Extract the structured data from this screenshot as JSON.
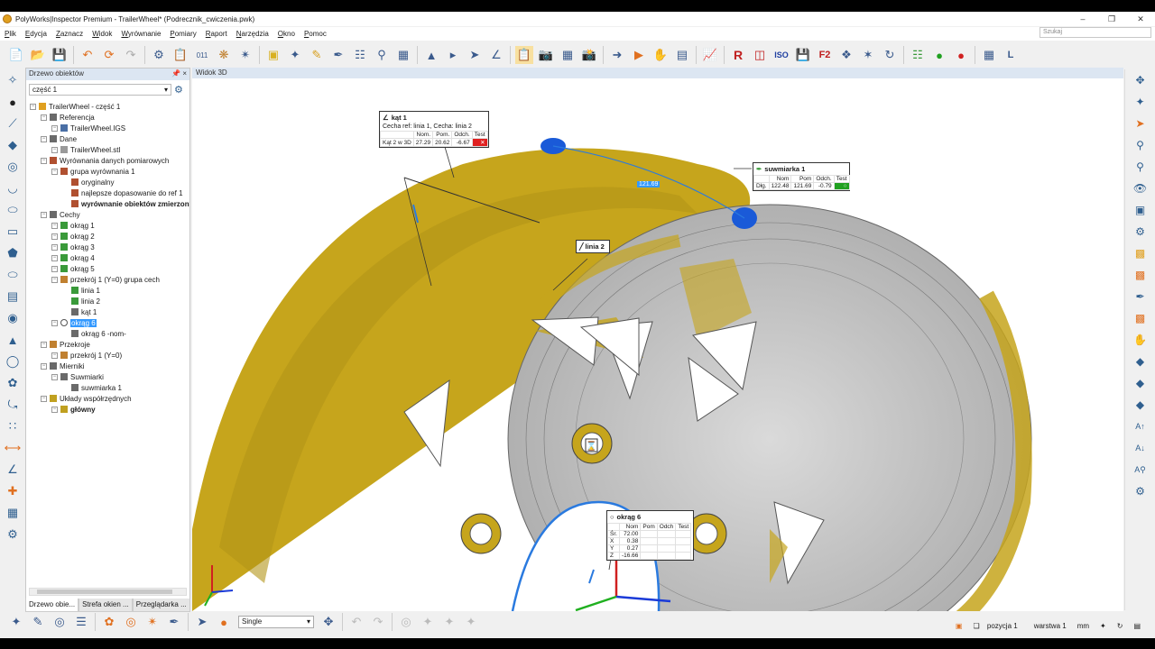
{
  "app_title": "PolyWorks|Inspector Premium - TrailerWheel* (Podrecznik_cwiczenia.pwk)",
  "menu": [
    "Plik",
    "Edycja",
    "Zaznacz",
    "Widok",
    "Wyrównanie",
    "Pomiary",
    "Raport",
    "Narzędzia",
    "Okno",
    "Pomoc"
  ],
  "search_placeholder": "Szukaj",
  "tree_panel": {
    "title": "Drzewo obiektów",
    "part_select": "część 1",
    "nodes": [
      {
        "label": "TrailerWheel - część 1",
        "lvl": 0,
        "icon": "#e0a020"
      },
      {
        "label": "Referencja",
        "lvl": 1,
        "icon": "#6a6a6a"
      },
      {
        "label": "TrailerWheel.IGS",
        "lvl": 2,
        "icon": "#4a6fa5"
      },
      {
        "label": "Dane",
        "lvl": 1,
        "icon": "#6a6a6a"
      },
      {
        "label": "TrailerWheel.stl",
        "lvl": 2,
        "icon": "#9a9a9a"
      },
      {
        "label": "Wyrównania danych pomiarowych",
        "lvl": 1,
        "icon": "#b05030"
      },
      {
        "label": "grupa wyrównania 1",
        "lvl": 2,
        "icon": "#b05030"
      },
      {
        "label": "oryginalny",
        "lvl": 3,
        "icon": "#b05030"
      },
      {
        "label": "najlepsze dopasowanie do ref 1",
        "lvl": 3,
        "icon": "#b05030"
      },
      {
        "label": "wyrównanie obiektów zmierzonych",
        "lvl": 3,
        "icon": "#b05030",
        "bold": true
      },
      {
        "label": "Cechy",
        "lvl": 1,
        "icon": "#6a6a6a"
      },
      {
        "label": "okrąg 1",
        "lvl": 2,
        "icon": "#3a9a3a"
      },
      {
        "label": "okrąg 2",
        "lvl": 2,
        "icon": "#3a9a3a"
      },
      {
        "label": "okrąg 3",
        "lvl": 2,
        "icon": "#3a9a3a"
      },
      {
        "label": "okrąg 4",
        "lvl": 2,
        "icon": "#3a9a3a"
      },
      {
        "label": "okrąg 5",
        "lvl": 2,
        "icon": "#3a9a3a"
      },
      {
        "label": "przekrój 1 (Y=0) grupa cech",
        "lvl": 2,
        "icon": "#c08030"
      },
      {
        "label": "linia 1",
        "lvl": 3,
        "icon": "#3a9a3a"
      },
      {
        "label": "linia 2",
        "lvl": 3,
        "icon": "#3a9a3a"
      },
      {
        "label": "kąt 1",
        "lvl": 3,
        "icon": "#6a6a6a"
      },
      {
        "label": "okrąg 6",
        "lvl": 2,
        "icon": "#ffffff",
        "selected": true
      },
      {
        "label": "okrąg 6 -nom-",
        "lvl": 3,
        "icon": "#6a6a6a"
      },
      {
        "label": "Przekroje",
        "lvl": 1,
        "icon": "#c08030"
      },
      {
        "label": "przekrój 1 (Y=0)",
        "lvl": 2,
        "icon": "#c08030"
      },
      {
        "label": "Mierniki",
        "lvl": 1,
        "icon": "#6a6a6a"
      },
      {
        "label": "Suwmiarki",
        "lvl": 2,
        "icon": "#6a6a6a"
      },
      {
        "label": "suwmiarka 1",
        "lvl": 3,
        "icon": "#6a6a6a"
      },
      {
        "label": "Układy współrzędnych",
        "lvl": 1,
        "icon": "#c0a020"
      },
      {
        "label": "główny",
        "lvl": 2,
        "icon": "#c0a020",
        "bold": true
      }
    ],
    "tabs": [
      "Drzewo obie...",
      "Strefa okien ...",
      "Przeglądarka ..."
    ]
  },
  "view": {
    "title": "Widok 3D",
    "dimension_tag": "121.69",
    "callout_kat": {
      "title": "kąt 1",
      "subtitle": "Cecha ref: linia 1,  Cecha: linia 2",
      "headers": [
        "",
        "Nom.",
        "Pom.",
        "Odch.",
        "Test"
      ],
      "row": [
        "Kąt 2 w 3D",
        "27.29",
        "20.62",
        "-6.67",
        ""
      ],
      "test_color": "#e02020"
    },
    "callout_suw": {
      "title": "suwmiarka 1",
      "headers": [
        "",
        "Nom",
        "Pom",
        "Odch.",
        "Test"
      ],
      "row": [
        "Dłg.",
        "122.48",
        "121.69",
        "-0.79",
        ""
      ],
      "test_color": "#20a020"
    },
    "callout_linia": {
      "title": "linia 2"
    },
    "callout_okrag": {
      "title": "okrąg 6",
      "headers": [
        "",
        "Nom",
        "Pom",
        "Odch",
        "Test"
      ],
      "rows": [
        [
          "Śr.",
          "72.00",
          "",
          "",
          ""
        ],
        [
          "X",
          "0.38",
          "",
          "",
          ""
        ],
        [
          "Y",
          "0.27",
          "",
          "",
          ""
        ],
        [
          "Z",
          "-16.66",
          "",
          "",
          ""
        ]
      ]
    }
  },
  "bottom": {
    "mode_select": "Single",
    "position": "pozycja 1",
    "layer": "warstwa 1",
    "units": "mm"
  },
  "colors": {
    "mesh_gold": "#c6a51c",
    "mesh_gray": "#c8c8c8",
    "accent": "#3399ff"
  }
}
